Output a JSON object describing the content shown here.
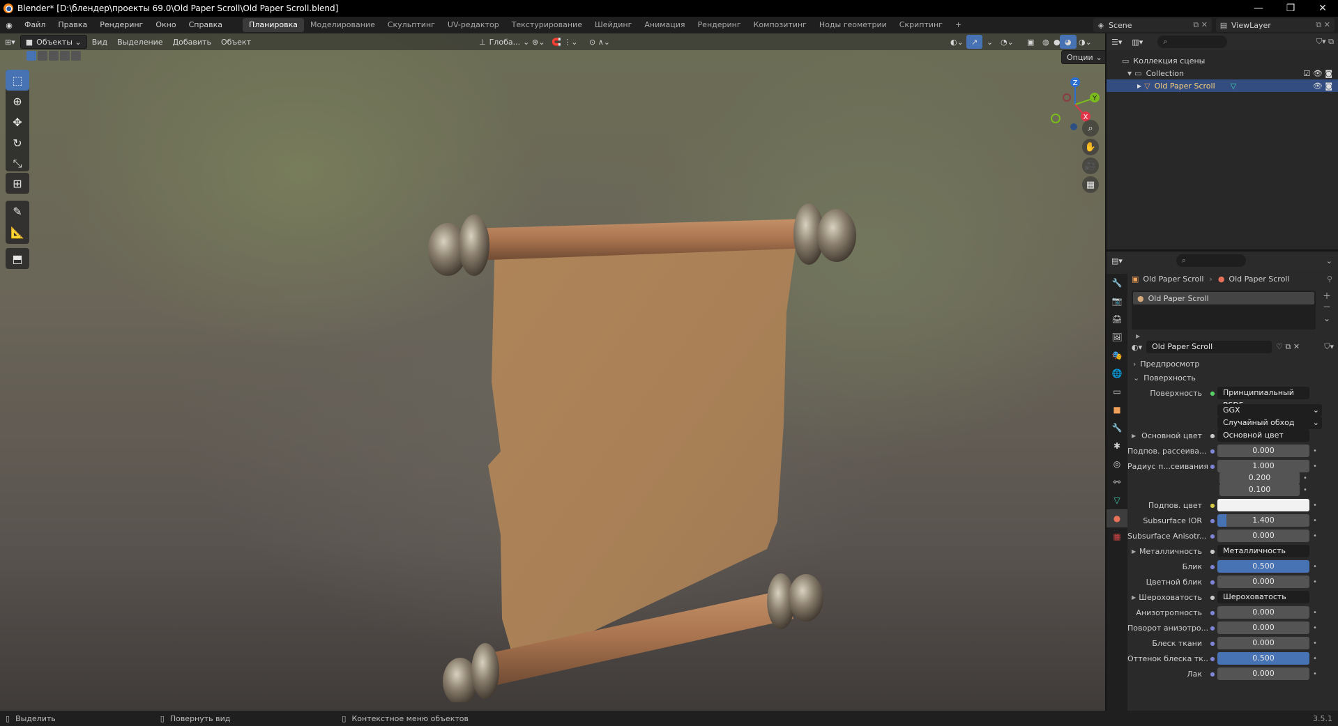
{
  "window": {
    "title": "Blender* [D:\\блендер\\проекты 69.0\\Old Paper Scroll\\Old Paper Scroll.blend]",
    "minimize": "—",
    "maximize": "❐",
    "close": "✕"
  },
  "menu": {
    "items": [
      "Файл",
      "Правка",
      "Рендеринг",
      "Окно",
      "Справка"
    ],
    "workspaces": [
      "Планировка",
      "Моделирование",
      "Скульптинг",
      "UV-редактор",
      "Текстурирование",
      "Шейдинг",
      "Анимация",
      "Рендеринг",
      "Композитинг",
      "Ноды геометрии",
      "Скриптинг"
    ],
    "active_workspace": "Планировка",
    "add_tab": "+",
    "scene": "Scene",
    "view_layer": "ViewLayer"
  },
  "viewport": {
    "mode": "Объекты",
    "menus": [
      "Вид",
      "Выделение",
      "Добавить",
      "Объект"
    ],
    "transform_orientation": "Глоба...",
    "options": "Опции",
    "gizmo_axes": {
      "x": "X",
      "y": "Y",
      "z": "Z"
    }
  },
  "outliner": {
    "search_placeholder": "",
    "scene_collection": "Коллекция сцены",
    "collection": "Collection",
    "object": "Old Paper Scroll"
  },
  "properties": {
    "breadcrumb_object": "Old Paper Scroll",
    "breadcrumb_material": "Old Paper Scroll",
    "slot_name": "Old Paper Scroll",
    "material_name": "Old Paper Scroll",
    "preview_section": "Предпросмотр",
    "surface_section": "Поверхность",
    "surface_label": "Поверхность",
    "surface_value": "Принципиальный BSDF",
    "distribution": "GGX",
    "subsurface_method": "Случайный обход",
    "rows": [
      {
        "label": "Основной цвет",
        "value": "Основной цвет",
        "type": "link",
        "expand": true
      },
      {
        "label": "Подпов. рассеива...",
        "value": "0.000",
        "type": "num"
      },
      {
        "label": "Радиус п...сеивания",
        "value": "1.000",
        "type": "num"
      },
      {
        "label": "",
        "value": "0.200",
        "type": "num"
      },
      {
        "label": "",
        "value": "0.100",
        "type": "num"
      },
      {
        "label": "Подпов. цвет",
        "value": "",
        "type": "color"
      },
      {
        "label": "Subsurface IOR",
        "value": "1.400",
        "type": "slider",
        "fill": 0.1
      },
      {
        "label": "Subsurface Anisotr...",
        "value": "0.000",
        "type": "num"
      },
      {
        "label": "Металличность",
        "value": "Металличность",
        "type": "link",
        "expand": true
      },
      {
        "label": "Блик",
        "value": "0.500",
        "type": "blue"
      },
      {
        "label": "Цветной блик",
        "value": "0.000",
        "type": "num"
      },
      {
        "label": "Шероховатость",
        "value": "Шероховатость",
        "type": "link",
        "expand": true
      },
      {
        "label": "Анизотропность",
        "value": "0.000",
        "type": "num"
      },
      {
        "label": "Поворот анизотро...",
        "value": "0.000",
        "type": "num"
      },
      {
        "label": "Блеск ткани",
        "value": "0.000",
        "type": "num"
      },
      {
        "label": "Оттенок блеска тк...",
        "value": "0.500",
        "type": "blue"
      },
      {
        "label": "Лак",
        "value": "0.000",
        "type": "num"
      }
    ]
  },
  "status": {
    "select": "Выделить",
    "rotate": "Повернуть вид",
    "context": "Контекстное меню объектов",
    "version": "3.5.1"
  }
}
